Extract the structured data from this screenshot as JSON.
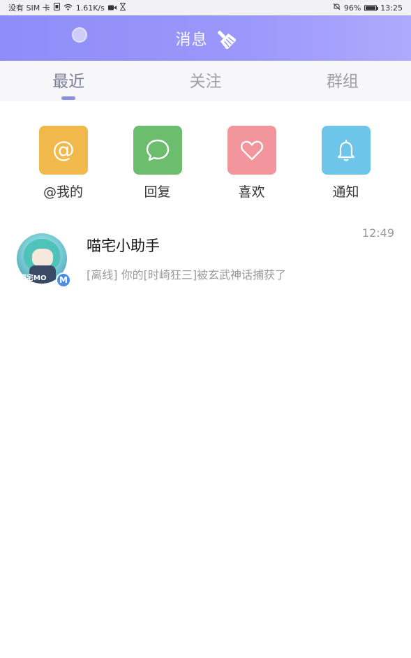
{
  "status_bar": {
    "carrier": "没有 SIM 卡",
    "speed": "1.61K/s",
    "battery": "96%",
    "battery_level": 0.96,
    "time": "13:25"
  },
  "header": {
    "title": "消息",
    "color": "#9b98fb"
  },
  "tabs": [
    {
      "label": "最近",
      "active": true
    },
    {
      "label": "关注",
      "active": false
    },
    {
      "label": "群组",
      "active": false
    }
  ],
  "quick_actions": [
    {
      "label": "@我的",
      "icon": "at-icon",
      "color": "#f1b84b"
    },
    {
      "label": "回复",
      "icon": "chat-bubble-icon",
      "color": "#6cbd6d"
    },
    {
      "label": "喜欢",
      "icon": "heart-icon",
      "color": "#f2959d"
    },
    {
      "label": "通知",
      "icon": "bell-icon",
      "color": "#6ec5ea"
    }
  ],
  "messages": [
    {
      "name": "喵宅小助手",
      "preview": "[离线] 你的[时崎狂三]被玄武神话捕获了",
      "time": "12:49",
      "avatar_text": "喵宅MO",
      "badge": "M"
    }
  ]
}
